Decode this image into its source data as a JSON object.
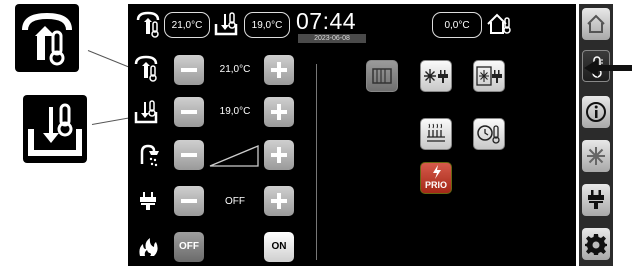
{
  "topbar": {
    "outdoor_temp": "21,0°C",
    "indoor_temp": "19,0°C",
    "time": "07:44",
    "date": "2023-06-08",
    "room_temp": "0,0°C"
  },
  "controls": {
    "rows": [
      {
        "value": "21,0°C"
      },
      {
        "value": "19,0°C"
      },
      {
        "value": ""
      },
      {
        "value": "OFF"
      }
    ],
    "heater_off_label": "OFF",
    "heater_on_label": "ON"
  },
  "tiles": {
    "prio_label": "PRIO"
  },
  "colors": {
    "screen_bg": "#000000",
    "button_grey": "#b4b4b4",
    "prio_red": "#c0392b"
  },
  "icons": [
    "thermometer-outdoor-icon",
    "thermometer-indoor-icon",
    "shower-icon",
    "plug-icon",
    "flame-icon",
    "home-icon",
    "thermometer-icon",
    "info-icon",
    "snowflake-icon",
    "gear-icon",
    "radiator-icon",
    "clock-icon"
  ]
}
